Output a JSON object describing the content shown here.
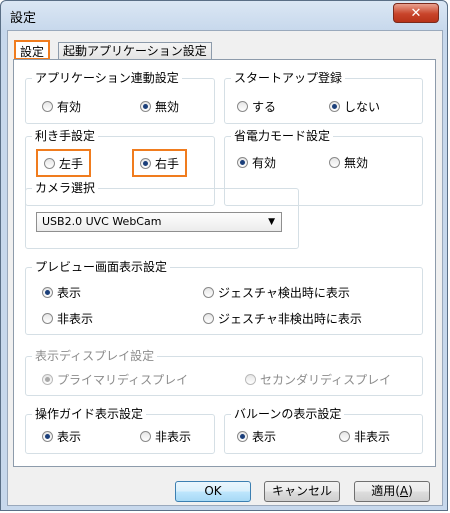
{
  "window": {
    "title": "設定",
    "close_label": "✕"
  },
  "tabs": [
    {
      "label": "設定",
      "active": true
    },
    {
      "label": "起動アプリケーション設定",
      "active": false
    }
  ],
  "groups": {
    "app_link": {
      "label": "アプリケーション連動設定",
      "options": [
        "有効",
        "無効"
      ],
      "selected": "無効"
    },
    "startup": {
      "label": "スタートアップ登録",
      "options": [
        "する",
        "しない"
      ],
      "selected": "しない"
    },
    "handedness": {
      "label": "利き手設定",
      "options": [
        "左手",
        "右手"
      ],
      "selected": "右手"
    },
    "power_save": {
      "label": "省電力モード設定",
      "options": [
        "有効",
        "無効"
      ],
      "selected": "有効"
    },
    "camera": {
      "label": "カメラ選択",
      "value": "USB2.0 UVC WebCam"
    },
    "preview": {
      "label": "プレビュー画面表示設定",
      "options": [
        "表示",
        "非表示",
        "ジェスチャ検出時に表示",
        "ジェスチャ非検出時に表示"
      ],
      "selected": "表示"
    },
    "display": {
      "label": "表示ディスプレイ設定",
      "options": [
        "プライマリディスプレイ",
        "セカンダリディスプレイ"
      ],
      "selected": "プライマリディスプレイ",
      "disabled": true
    },
    "guide": {
      "label": "操作ガイド表示設定",
      "options": [
        "表示",
        "非表示"
      ],
      "selected": "表示"
    },
    "balloon": {
      "label": "バルーンの表示設定",
      "options": [
        "表示",
        "非表示"
      ],
      "selected": "表示"
    }
  },
  "buttons": {
    "ok": "OK",
    "cancel": "キャンセル",
    "apply": "適用(",
    "apply_accel": "A",
    "apply_end": ")"
  },
  "colors": {
    "highlight": "#f07c1e",
    "radio_dot": "#1b3f7a"
  }
}
